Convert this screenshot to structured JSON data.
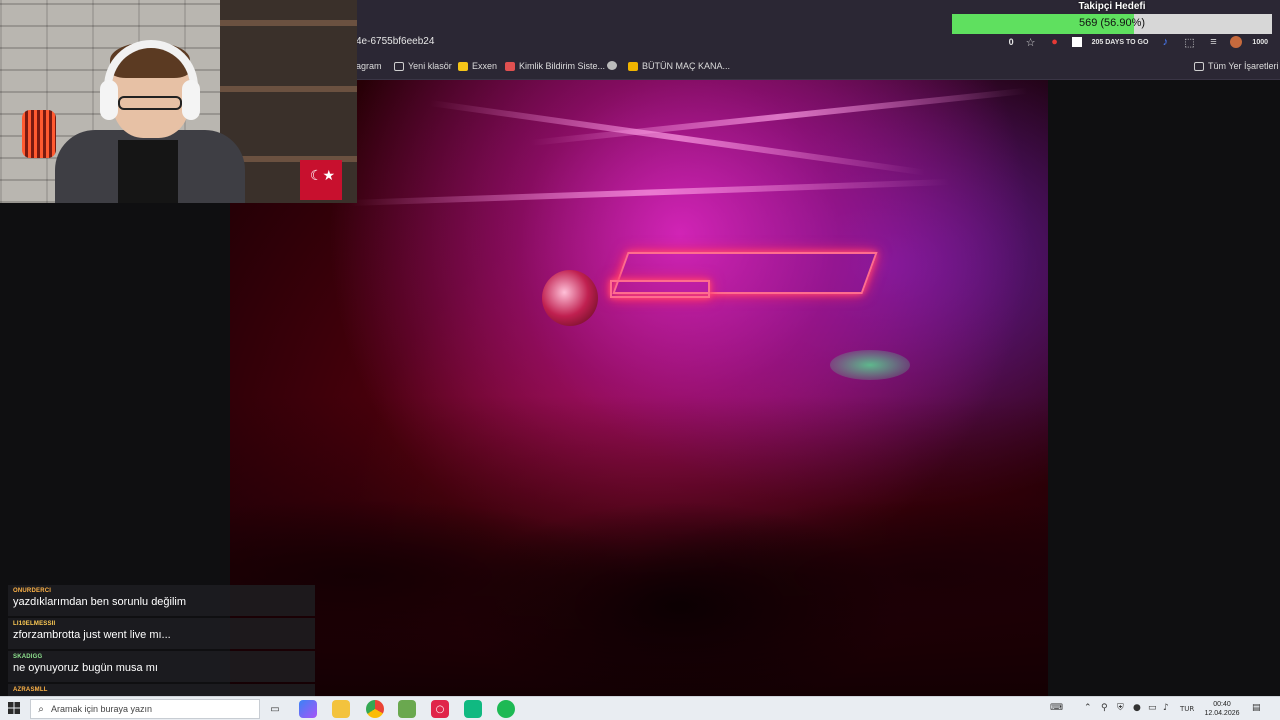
{
  "browser": {
    "url_partial": "4e-6755bf6eeb24",
    "toolbar_counter": "0",
    "toolbar_overlay_text": "205 DAYS TO GO",
    "toolbar_count_right": "1000",
    "bookmarks": [
      {
        "label": "agram",
        "icon": "bookmark-icon",
        "color": "#cc4488"
      },
      {
        "label": "Yeni klasör",
        "icon": "folder-icon",
        "color": "#d8d8d8"
      },
      {
        "label": "Exxen",
        "icon": "exxen-icon",
        "color": "#f5c518"
      },
      {
        "label": "Kimlik Bildirim Siste...",
        "icon": "id-icon",
        "color": "#e05050"
      },
      {
        "label": "",
        "icon": "globe-icon",
        "color": "#bbbbbb"
      },
      {
        "label": "BÜTÜN MAÇ KANA...",
        "icon": "jp-icon",
        "color": "#f0b400"
      }
    ],
    "all_bookmarks_label": "Tüm Yer İşaretleri"
  },
  "goal": {
    "title": "Takipçi Hedefi",
    "text": "569 (56.90%)",
    "progress": 0.569,
    "fill_color": "#5fe05f"
  },
  "chat": [
    {
      "user": "ONURDERCI",
      "message": "yazdıklarımdan ben sorunlu değilim"
    },
    {
      "user": "LI10ELMESSII",
      "message": "zforzambrotta just went live mı..."
    },
    {
      "user": "SKADIGG",
      "message": "ne oynuyoruz bugün musa mı"
    },
    {
      "user": "AZRASMLL",
      "message": ""
    }
  ],
  "taskbar": {
    "search_placeholder": "Aramak için buraya yazın",
    "language": "TUR",
    "time": "00:40",
    "date": "12.04.2026",
    "apps": [
      "task-view-icon",
      "copilot-icon",
      "file-explorer-icon",
      "chrome-icon",
      "app-icon",
      "opera-icon",
      "twitch-icon",
      "spotify-icon"
    ]
  }
}
